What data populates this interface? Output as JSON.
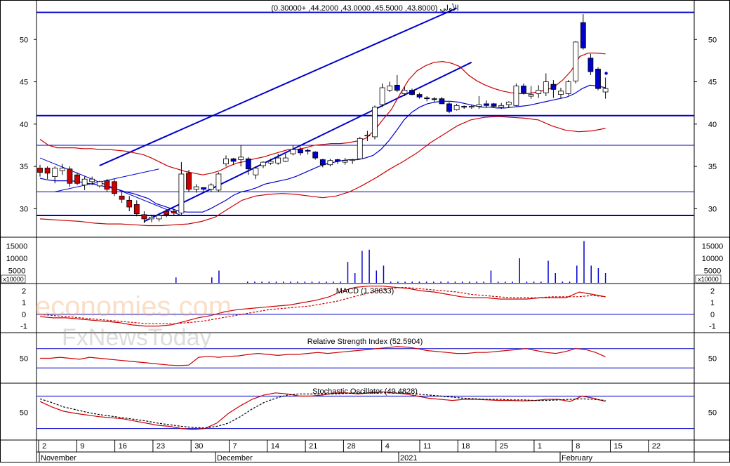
{
  "chart_data": [
    {
      "type": "candlestick",
      "title": "الأولى (43.8000, 45.5000, 43.0000, 44.2000, +0.30000)",
      "ylim": [
        26.8,
        54.5
      ],
      "yticks": [
        30,
        35,
        40,
        45,
        50
      ],
      "horizontal_lines": [
        53.2,
        41.0,
        37.5,
        32.0,
        29.2
      ],
      "channel_lines": [
        {
          "x": [
            8,
            56
          ],
          "y": [
            35.1,
            53.7
          ]
        },
        {
          "x": [
            14,
            58
          ],
          "y": [
            28.5,
            47.3
          ]
        },
        {
          "x": [
            0,
            19
          ],
          "y": [
            36.0,
            29.2
          ]
        },
        {
          "x": [
            2,
            16
          ],
          "y": [
            32.0,
            34.7
          ]
        }
      ],
      "candles": [
        {
          "o": 34.3,
          "h": 35.2,
          "l": 33.8,
          "c": 34.8,
          "up": false
        },
        {
          "o": 34.2,
          "h": 35.0,
          "l": 33.5,
          "c": 34.8,
          "up": false
        },
        {
          "o": 33.8,
          "h": 35.0,
          "l": 33.0,
          "c": 34.8,
          "up": true
        },
        {
          "o": 34.5,
          "h": 35.3,
          "l": 34.0,
          "c": 34.8,
          "up": true
        },
        {
          "o": 34.7,
          "h": 35.0,
          "l": 32.6,
          "c": 33.0,
          "up": false
        },
        {
          "o": 34.0,
          "h": 34.3,
          "l": 32.8,
          "c": 33.0,
          "up": false
        },
        {
          "o": 32.8,
          "h": 33.8,
          "l": 32.2,
          "c": 33.5,
          "up": true
        },
        {
          "o": 33.2,
          "h": 33.8,
          "l": 32.8,
          "c": 33.5,
          "up": true
        },
        {
          "o": 32.7,
          "h": 33.3,
          "l": 32.5,
          "c": 33.2,
          "up": true
        },
        {
          "o": 33.3,
          "h": 33.5,
          "l": 32.0,
          "c": 32.3,
          "up": false
        },
        {
          "o": 33.2,
          "h": 33.5,
          "l": 31.5,
          "c": 31.8,
          "up": false
        },
        {
          "o": 31.5,
          "h": 32.0,
          "l": 30.7,
          "c": 31.1,
          "up": false
        },
        {
          "o": 31.0,
          "h": 31.5,
          "l": 29.7,
          "c": 30.2,
          "up": false
        },
        {
          "o": 30.5,
          "h": 31.0,
          "l": 29.1,
          "c": 29.4,
          "up": false
        },
        {
          "o": 29.3,
          "h": 29.7,
          "l": 28.3,
          "c": 28.8,
          "up": false
        },
        {
          "o": 28.8,
          "h": 29.3,
          "l": 28.4,
          "c": 29.0,
          "up": true
        },
        {
          "o": 28.8,
          "h": 29.5,
          "l": 28.5,
          "c": 29.2,
          "up": true
        },
        {
          "o": 29.3,
          "h": 29.8,
          "l": 29.0,
          "c": 29.7,
          "up": false
        },
        {
          "o": 29.5,
          "h": 30.0,
          "l": 29.2,
          "c": 29.7,
          "up": false
        },
        {
          "o": 29.5,
          "h": 35.5,
          "l": 29.3,
          "c": 34.1,
          "up": true
        },
        {
          "o": 34.2,
          "h": 34.6,
          "l": 32.0,
          "c": 32.3,
          "up": false
        },
        {
          "o": 32.3,
          "h": 32.9,
          "l": 31.9,
          "c": 32.6,
          "up": true
        },
        {
          "o": 32.3,
          "h": 32.5,
          "l": 32.0,
          "c": 32.5,
          "up": false
        },
        {
          "o": 32.3,
          "h": 33.0,
          "l": 32.0,
          "c": 32.8,
          "up": true
        },
        {
          "o": 32.2,
          "h": 34.3,
          "l": 32.0,
          "c": 34.1,
          "up": true
        },
        {
          "o": 35.3,
          "h": 36.3,
          "l": 35.0,
          "c": 35.9,
          "up": true
        },
        {
          "o": 35.6,
          "h": 36.0,
          "l": 35.2,
          "c": 35.9,
          "up": false
        },
        {
          "o": 35.8,
          "h": 37.5,
          "l": 35.0,
          "c": 36.1,
          "up": true
        },
        {
          "o": 35.9,
          "h": 36.1,
          "l": 34.0,
          "c": 34.7,
          "up": false
        },
        {
          "o": 34.0,
          "h": 35.0,
          "l": 33.5,
          "c": 34.8,
          "up": true
        },
        {
          "o": 35.1,
          "h": 35.6,
          "l": 34.8,
          "c": 35.5,
          "up": true
        },
        {
          "o": 35.4,
          "h": 35.9,
          "l": 35.2,
          "c": 35.6,
          "up": true
        },
        {
          "o": 35.4,
          "h": 36.5,
          "l": 35.2,
          "c": 36.0,
          "up": true
        },
        {
          "o": 36.0,
          "h": 36.5,
          "l": 35.5,
          "c": 35.6,
          "up": true
        },
        {
          "o": 36.5,
          "h": 37.5,
          "l": 36.3,
          "c": 37.0,
          "up": true
        },
        {
          "o": 37.0,
          "h": 37.3,
          "l": 36.3,
          "c": 36.6,
          "up": false
        },
        {
          "o": 36.9,
          "h": 37.1,
          "l": 36.4,
          "c": 36.8,
          "up": false
        },
        {
          "o": 36.7,
          "h": 36.8,
          "l": 35.8,
          "c": 36.0,
          "up": false
        },
        {
          "o": 35.8,
          "h": 35.9,
          "l": 34.9,
          "c": 35.2,
          "up": false
        },
        {
          "o": 35.2,
          "h": 35.9,
          "l": 35.0,
          "c": 35.7,
          "up": true
        },
        {
          "o": 35.6,
          "h": 35.9,
          "l": 35.3,
          "c": 35.8,
          "up": false
        },
        {
          "o": 35.5,
          "h": 36.0,
          "l": 35.2,
          "c": 35.7,
          "up": true
        },
        {
          "o": 35.7,
          "h": 35.9,
          "l": 35.3,
          "c": 35.8,
          "up": true
        },
        {
          "o": 35.9,
          "h": 38.5,
          "l": 35.8,
          "c": 38.3,
          "up": true
        },
        {
          "o": 38.6,
          "h": 39.2,
          "l": 38.0,
          "c": 38.7,
          "up": true
        },
        {
          "o": 38.5,
          "h": 42.2,
          "l": 38.2,
          "c": 42.0,
          "up": true
        },
        {
          "o": 42.3,
          "h": 44.8,
          "l": 42.0,
          "c": 44.3,
          "up": true
        },
        {
          "o": 44.0,
          "h": 45.0,
          "l": 43.8,
          "c": 44.5,
          "up": true
        },
        {
          "o": 44.6,
          "h": 45.8,
          "l": 43.8,
          "c": 44.0,
          "up": false
        },
        {
          "o": 43.6,
          "h": 44.4,
          "l": 43.3,
          "c": 44.0,
          "up": true
        },
        {
          "o": 44.0,
          "h": 44.2,
          "l": 43.4,
          "c": 43.5,
          "up": false
        },
        {
          "o": 43.5,
          "h": 43.7,
          "l": 43.0,
          "c": 43.2,
          "up": false
        },
        {
          "o": 43.0,
          "h": 43.3,
          "l": 42.7,
          "c": 43.1,
          "up": false
        },
        {
          "o": 42.9,
          "h": 43.2,
          "l": 42.6,
          "c": 43.0,
          "up": false
        },
        {
          "o": 43.0,
          "h": 43.2,
          "l": 42.4,
          "c": 42.4,
          "up": false
        },
        {
          "o": 42.4,
          "h": 42.6,
          "l": 41.3,
          "c": 41.5,
          "up": false
        },
        {
          "o": 41.7,
          "h": 42.4,
          "l": 41.6,
          "c": 42.2,
          "up": true
        },
        {
          "o": 42.0,
          "h": 42.2,
          "l": 41.8,
          "c": 42.1,
          "up": false
        },
        {
          "o": 42.0,
          "h": 42.3,
          "l": 41.8,
          "c": 42.1,
          "up": true
        }
      ],
      "candles_tail": [
        {
          "o": 42.1,
          "h": 43.3,
          "l": 41.8,
          "c": 42.3,
          "up": true
        },
        {
          "o": 42.4,
          "h": 42.8,
          "l": 41.9,
          "c": 42.2,
          "up": false
        },
        {
          "o": 42.4,
          "h": 42.5,
          "l": 42.0,
          "c": 42.1,
          "up": false
        },
        {
          "o": 42.0,
          "h": 42.5,
          "l": 41.8,
          "c": 42.2,
          "up": true
        },
        {
          "o": 42.3,
          "h": 42.7,
          "l": 41.9,
          "c": 42.6,
          "up": true
        },
        {
          "o": 42.2,
          "h": 44.8,
          "l": 42.1,
          "c": 44.5,
          "up": true
        },
        {
          "o": 44.5,
          "h": 44.8,
          "l": 43.5,
          "c": 43.7,
          "up": false
        },
        {
          "o": 43.3,
          "h": 44.5,
          "l": 43.0,
          "c": 43.5,
          "up": true
        },
        {
          "o": 43.6,
          "h": 44.6,
          "l": 43.1,
          "c": 44.0,
          "up": true
        },
        {
          "o": 43.7,
          "h": 46.0,
          "l": 43.3,
          "c": 45.0,
          "up": true
        },
        {
          "o": 44.7,
          "h": 45.2,
          "l": 43.1,
          "c": 44.1,
          "up": false
        },
        {
          "o": 43.5,
          "h": 44.3,
          "l": 43.0,
          "c": 43.9,
          "up": true
        },
        {
          "o": 43.6,
          "h": 45.2,
          "l": 43.4,
          "c": 45.0,
          "up": true
        },
        {
          "o": 45.1,
          "h": 49.8,
          "l": 44.8,
          "c": 49.7,
          "up": true
        },
        {
          "o": 52.0,
          "h": 53.0,
          "l": 48.8,
          "c": 49.0,
          "up": false
        },
        {
          "o": 47.8,
          "h": 48.3,
          "l": 45.8,
          "c": 46.2,
          "up": false
        },
        {
          "o": 46.5,
          "h": 46.7,
          "l": 44.0,
          "c": 44.2,
          "up": false
        },
        {
          "o": 43.8,
          "h": 45.5,
          "l": 43.0,
          "c": 44.2,
          "up": true
        }
      ],
      "last_point": 46.0,
      "bollinger_middle": [
        33.6,
        33.4,
        33.3,
        33.3,
        33.3,
        33.2,
        33.0,
        32.9,
        32.7,
        32.5,
        32.3,
        32.0,
        31.8,
        31.5,
        31.2,
        30.6,
        30.3,
        30.0,
        29.7,
        29.6,
        29.6,
        29.6,
        30.0,
        30.5,
        31.0,
        31.6,
        32.0,
        32.2,
        32.5,
        32.9,
        33.1,
        33.3,
        33.5,
        33.8,
        34.2,
        34.6,
        35.0,
        35.3,
        35.5,
        35.7,
        35.8,
        35.8,
        36.0,
        36.3,
        37.0,
        38.0,
        39.2,
        40.5,
        41.4,
        42.0,
        42.4,
        42.6,
        42.7,
        42.7,
        42.6,
        42.4,
        42.2,
        42.0,
        42.0,
        41.9,
        41.9,
        42.0,
        42.1,
        42.2,
        42.4,
        42.6,
        42.8,
        43.0,
        43.2,
        43.6,
        44.2,
        44.6,
        44.5,
        44.3
      ],
      "bollinger_upper": [
        38.2,
        37.5,
        37.2,
        37.2,
        37.2,
        37.1,
        37.1,
        37.0,
        37.0,
        36.9,
        36.8,
        36.6,
        36.4,
        36.0,
        35.5,
        35.0,
        34.7,
        34.4,
        34.2,
        34.0,
        34.2,
        34.5,
        35.0,
        35.4,
        35.6,
        35.9,
        36.1,
        36.4,
        36.7,
        37.0,
        37.0,
        37.2,
        37.5,
        37.6,
        37.7,
        37.7,
        37.8,
        38.0,
        38.3,
        39.2,
        40.5,
        41.7,
        43.5,
        45.2,
        46.3,
        46.9,
        47.3,
        47.4,
        47.2,
        46.8,
        45.8,
        45.1,
        44.6,
        44.2,
        43.9,
        43.7,
        43.6,
        43.6,
        43.8,
        44.0,
        44.4,
        45.2,
        46.3,
        48.0,
        48.4,
        48.4,
        48.3
      ],
      "bollinger_lower": [
        28.8,
        28.7,
        28.6,
        28.5,
        28.3,
        28.2,
        28.2,
        28.1,
        28.0,
        28.0,
        28.1,
        28.2,
        28.5,
        29.0,
        30.0,
        31.0,
        31.5,
        31.7,
        31.8,
        31.7,
        31.5,
        31.3,
        31.5,
        32.0,
        32.8,
        33.7,
        34.7,
        35.6,
        36.6,
        37.8,
        38.8,
        39.8,
        40.5,
        40.8,
        40.9,
        40.8,
        40.7,
        40.5,
        39.8,
        39.3,
        39.1,
        39.2,
        39.5
      ]
    },
    {
      "type": "bar",
      "title": "",
      "ytick_labels": [
        "15000",
        "10000",
        "5000"
      ],
      "multiplier_label": "x10000",
      "ylim": [
        0,
        18000
      ],
      "values": [
        0,
        0,
        0,
        0,
        0,
        0,
        0,
        0,
        0,
        0,
        0,
        0,
        0,
        0,
        0,
        0,
        0,
        0,
        0,
        2200,
        0,
        0,
        0,
        0,
        2200,
        5000,
        0,
        0,
        0,
        500,
        500,
        500,
        500,
        500,
        500,
        500,
        500,
        500,
        500,
        500,
        500,
        500,
        500,
        8500,
        4000,
        13000,
        13500,
        5000,
        7000,
        500,
        500,
        500,
        500,
        500,
        500,
        500,
        500,
        500,
        500,
        500,
        500,
        500,
        500,
        5000,
        500,
        500,
        500,
        10000,
        500,
        500,
        500,
        9000,
        4000,
        500,
        500,
        7000,
        17000,
        7000,
        6000,
        4000
      ],
      "color": "#0000cc"
    },
    {
      "type": "line",
      "title": "MACD (1.38633)",
      "ytick_labels": [
        "2",
        "1",
        "0",
        "-1"
      ],
      "ylim": [
        -1.5,
        2.5
      ],
      "macd": [
        -0.2,
        -0.3,
        -0.3,
        -0.4,
        -0.5,
        -0.6,
        -0.7,
        -0.9,
        -1.0,
        -1.0,
        -0.9,
        -0.6,
        -0.3,
        -0.1,
        0.2,
        0.4,
        0.5,
        0.6,
        0.7,
        0.8,
        1.0,
        1.2,
        1.5,
        2.0,
        2.3,
        2.4,
        2.4,
        2.3,
        2.2,
        2.0,
        1.9,
        1.7,
        1.5,
        1.4,
        1.4,
        1.3,
        1.3,
        1.3,
        1.4,
        1.4,
        1.4,
        1.9,
        1.7,
        1.5
      ],
      "signal": [
        0.0,
        -0.1,
        -0.2,
        -0.3,
        -0.4,
        -0.5,
        -0.6,
        -0.7,
        -0.8,
        -0.8,
        -0.8,
        -0.7,
        -0.6,
        -0.4,
        -0.2,
        0.0,
        0.2,
        0.4,
        0.5,
        0.6,
        0.7,
        0.9,
        1.1,
        1.4,
        1.7,
        2.0,
        2.2,
        2.3,
        2.2,
        2.1,
        2.0,
        1.9,
        1.7,
        1.6,
        1.5,
        1.4,
        1.4,
        1.4,
        1.5,
        1.5,
        1.5,
        1.6,
        1.5
      ]
    },
    {
      "type": "line",
      "title": "Relative Strength Index (52.5904)",
      "ytick_labels": [
        "50"
      ],
      "ylim": [
        0,
        100
      ],
      "horizontal_lines": [
        70,
        30
      ],
      "values": [
        50,
        50,
        52,
        50,
        48,
        52,
        50,
        48,
        46,
        44,
        42,
        40,
        38,
        36,
        35,
        36,
        52,
        54,
        52,
        54,
        55,
        58,
        60,
        58,
        56,
        58,
        58,
        60,
        62,
        60,
        62,
        64,
        66,
        68,
        70,
        72,
        74,
        73,
        70,
        66,
        64,
        62,
        60,
        60,
        62,
        62,
        64,
        66,
        68,
        70,
        66,
        62,
        60,
        64,
        70,
        68,
        62,
        53
      ]
    },
    {
      "type": "line",
      "title": "Stochastic Oscillator (49.4828)",
      "ytick_labels": [
        "50"
      ],
      "ylim": [
        0,
        100
      ],
      "horizontal_lines": [
        80,
        20
      ],
      "k": [
        70,
        60,
        52,
        48,
        45,
        42,
        40,
        38,
        34,
        30,
        26,
        24,
        20,
        18,
        20,
        30,
        48,
        62,
        74,
        82,
        86,
        84,
        80,
        80,
        82,
        86,
        86,
        84,
        86,
        88,
        86,
        84,
        80,
        76,
        74,
        72,
        74,
        74,
        73,
        72,
        72,
        71,
        72,
        74,
        74,
        70,
        80,
        76,
        70
      ],
      "d": [
        75,
        68,
        60,
        55,
        50,
        46,
        43,
        40,
        37,
        34,
        30,
        27,
        24,
        22,
        21,
        24,
        30,
        42,
        56,
        68,
        76,
        82,
        84,
        84,
        84,
        84,
        85,
        86,
        86,
        86,
        86,
        86,
        84,
        82,
        80,
        78,
        76,
        75,
        74,
        74,
        73,
        73,
        72,
        72,
        73,
        74,
        75,
        74,
        72
      ]
    }
  ],
  "x_axis": {
    "ticks": [
      "2",
      "9",
      "16",
      "23",
      "30",
      "7",
      "14",
      "21",
      "28",
      "4",
      "11",
      "18",
      "25",
      "1",
      "8",
      "15",
      "22"
    ],
    "months": [
      "November",
      "December",
      "2021",
      "February"
    ]
  },
  "watermarks": [
    "economies.com",
    "FxNewsToday"
  ]
}
